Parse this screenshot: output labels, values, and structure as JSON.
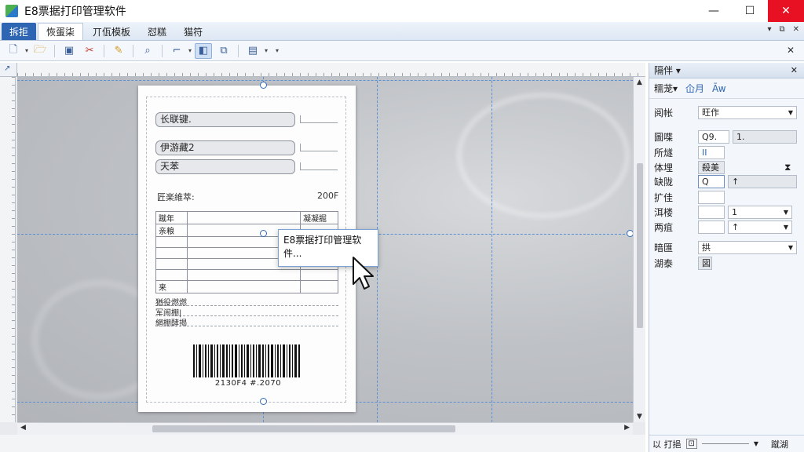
{
  "app": {
    "title": "E8票据打印管理软件"
  },
  "window": {
    "minimize": "—",
    "maximize": "☐",
    "close": "✕"
  },
  "menu": {
    "items": [
      "拆拒",
      "恢蛋柒",
      "丌佤模板",
      "怼糕",
      "猫符"
    ],
    "mdi": [
      "▾",
      "⧉",
      "✕"
    ]
  },
  "toolbar": {
    "buttons": [
      "new-doc-icon",
      "open-folder-icon",
      "save-icon",
      "cut-icon",
      "paste-icon",
      "search-icon",
      "format-icon",
      "select-icon",
      "layers-icon",
      "field-icon"
    ],
    "close": "✕"
  },
  "ruler": {
    "corner": "↗"
  },
  "paper": {
    "fields": [
      "长联键.",
      "伊游藏2",
      "天苯"
    ],
    "date_label": "匠楽維萃:",
    "date_value": "200F",
    "table": [
      [
        "蹴年",
        "",
        "凝凝掘"
      ],
      [
        "亲粮",
        "",
        ""
      ],
      [
        "",
        "",
        ""
      ],
      [
        "",
        "",
        ""
      ],
      [
        "",
        "",
        ""
      ],
      [
        "",
        "",
        ""
      ],
      [
        "来",
        "",
        ""
      ]
    ],
    "sig_rows": [
      "猶役燃燃",
      "军闹棚|",
      "網棚酵揭"
    ],
    "barcode_text": "2130F4 #.2070"
  },
  "tooltip": {
    "text": "E8票据打印管理软件..."
  },
  "panel": {
    "title": "隔伴 ▾",
    "close": "✕",
    "tabs": [
      "糯茏▾",
      "仚月",
      "Ãw"
    ],
    "rows": [
      {
        "key": "阅帐",
        "value": "旺作",
        "kind": "dropdown"
      },
      {
        "key": "圖喋",
        "value": "Q9.",
        "value2": "1.",
        "kind": "pair"
      },
      {
        "key": "所燧",
        "value": "II",
        "kind": "small"
      },
      {
        "key": "体埋",
        "value": "殺美1",
        "kind": "small"
      },
      {
        "key": "缺陇",
        "value": "Q",
        "value2": "↑",
        "kind": "pair"
      },
      {
        "key": "扩佳",
        "value": "",
        "kind": "plain"
      },
      {
        "key": "洱楼",
        "value": "1",
        "kind": "dropdown"
      },
      {
        "key": "两疽",
        "value": "↑",
        "kind": "dropdown"
      },
      {
        "key": "暗匯",
        "value": "拱",
        "kind": "dropdown"
      },
      {
        "key": "湖泰",
        "value": "図",
        "kind": "tiny"
      }
    ],
    "status_left": "以 打挹",
    "status_right": "蹴湖"
  }
}
